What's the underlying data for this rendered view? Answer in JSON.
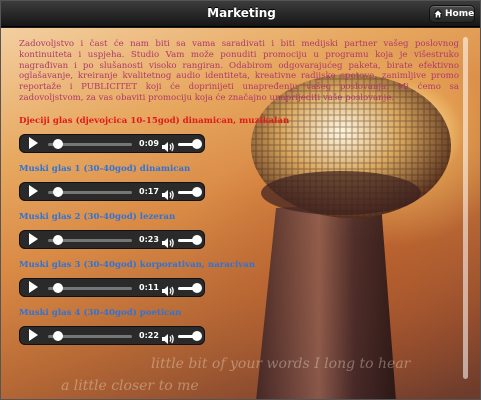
{
  "header": {
    "title": "Marketing",
    "home_label": "Home",
    "home_icon": "home-icon"
  },
  "intro": {
    "text": "Zadovoljstvo i čast će nam biti sa vama saradivati i biti medijski partner vašeg poslovnog kontinuiteta i uspjeha. Studio Vam može ponuditi promociju u programu koja je višestruko nagrađivan i po slušanosti visoko rangiran. Odabirom odgovarajućeg paketa, birate efektivno oglašavanje, kreiranje kvalitetnog audio identiteta, kreativne radijske spotove, zanimljive promo reportaže i PUBLICITET koji će doprinijeti unapređenju vašeg poslovanja. Mi ćemo sa zadovoljstvom, za vas obaviti promociju koja će značajno unaprijediti vaše poslovanje."
  },
  "tracks": [
    {
      "title": "Djeciji glas (djevojcica 10-15god) dinamican, muzikalan",
      "time": "0:09",
      "color": "#e21a1a"
    },
    {
      "title": "Muski glas 1 (30-40god) dinamican",
      "time": "0:17",
      "color": "#2f73d6"
    },
    {
      "title": "Muski glas 2 (30-40god) lezeran",
      "time": "0:23",
      "color": "#2f73d6"
    },
    {
      "title": "Muski glas 3 (30-40god) korporativan, naracivan",
      "time": "0:11",
      "color": "#2f73d6"
    },
    {
      "title": "Muski glas 4 (30-40god) poetican",
      "time": "0:22",
      "color": "#2f73d6"
    }
  ],
  "player_icons": {
    "play": "play-icon",
    "volume": "volume-icon"
  },
  "background_script": [
    "little bit of your words I long to hear",
    "a little closer to me"
  ]
}
